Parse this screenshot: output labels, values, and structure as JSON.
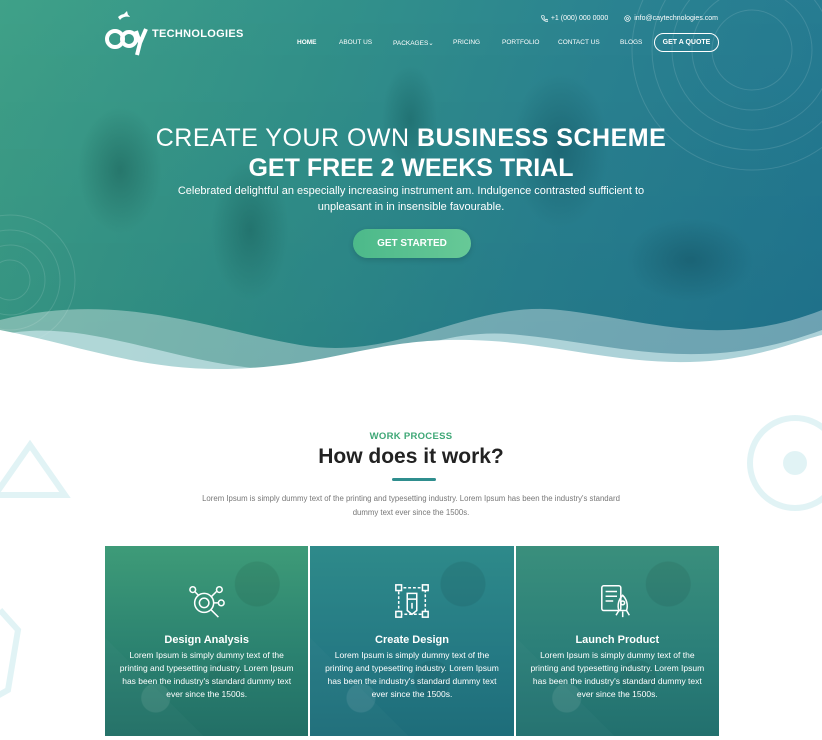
{
  "brand": {
    "logo_letters": "cay",
    "logo_text": "TECHNOLOGIES"
  },
  "topbar": {
    "phone": "+1 (000) 000 0000",
    "email": "info@caytechnologies.com"
  },
  "nav": {
    "items": [
      "HOME",
      "ABOUT US",
      "PACKAGES",
      "PRICING",
      "PORTFOLIO",
      "CONTACT US",
      "BLOGS"
    ],
    "cta": "GET A QUOTE"
  },
  "hero": {
    "title_light": "CREATE YOUR OWN",
    "title_bold": "BUSINESS SCHEME",
    "title_line2": "GET FREE 2 WEEKS TRIAL",
    "description": "Celebrated delightful an especially increasing instrument am. Indulgence contrasted sufficient to unpleasant in in insensible favourable.",
    "button": "GET STARTED"
  },
  "work_process": {
    "label": "WORK PROCESS",
    "title": "How does it work?",
    "description": "Lorem Ipsum is simply dummy text of the printing and typesetting industry. Lorem Ipsum has been the industry's standard dummy text ever since the 1500s."
  },
  "cards": [
    {
      "icon": "design-analysis-icon",
      "title": "Design Analysis",
      "text": "Lorem Ipsum is simply dummy text of the printing and typesetting industry. Lorem Ipsum has been the industry's standard dummy text ever since the 1500s."
    },
    {
      "icon": "create-design-icon",
      "title": "Create Design",
      "text": "Lorem Ipsum is simply dummy text of the printing and typesetting industry. Lorem Ipsum has been the industry's standard dummy text ever since the 1500s."
    },
    {
      "icon": "launch-product-icon",
      "title": "Launch Product",
      "text": "Lorem Ipsum is simply dummy text of the printing and typesetting industry. Lorem Ipsum has been the industry's standard dummy text ever since the 1500s."
    }
  ],
  "colors": {
    "hero_start": "#3c9f86",
    "hero_end": "#1f7590",
    "accent_green": "#3ea776",
    "button_green": "#4cb98a",
    "underline": "#2f8e8e"
  }
}
